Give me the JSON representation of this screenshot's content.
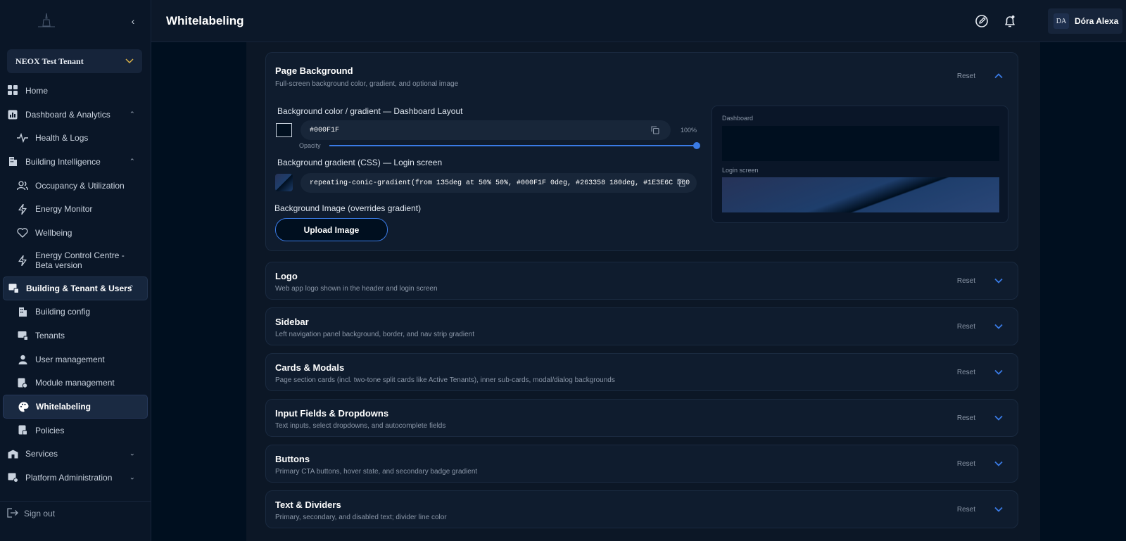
{
  "app": {
    "tenant": "NEOX Test Tenant",
    "page_title": "Whitelabeling",
    "user": {
      "initials": "DA",
      "name": "Dóra Alexa"
    },
    "sign_out": "Sign out"
  },
  "sidebar": {
    "items": [
      {
        "label": "Home",
        "icon": "grid-icon"
      },
      {
        "label": "Dashboard & Analytics",
        "icon": "chart-icon"
      },
      {
        "label": "Health & Logs",
        "icon": "pulse-icon"
      },
      {
        "label": "Building Intelligence",
        "icon": "building-icon"
      },
      {
        "label": "Occupancy & Utilization",
        "icon": "users-icon"
      },
      {
        "label": "Energy Monitor",
        "icon": "bolt-icon"
      },
      {
        "label": "Wellbeing",
        "icon": "heart-icon"
      },
      {
        "label": "Energy Control Centre - Beta version",
        "icon": "bolt-icon"
      },
      {
        "label": "Building & Tenant & Users",
        "icon": "org-icon"
      },
      {
        "label": "Building config",
        "icon": "building-icon"
      },
      {
        "label": "Tenants",
        "icon": "tenants-icon"
      },
      {
        "label": "User management",
        "icon": "user-icon"
      },
      {
        "label": "Module management",
        "icon": "module-icon"
      },
      {
        "label": "Whitelabeling",
        "icon": "palette-icon"
      },
      {
        "label": "Policies",
        "icon": "policy-icon"
      },
      {
        "label": "Services",
        "icon": "services-icon"
      },
      {
        "label": "Platform Administration",
        "icon": "admin-icon"
      }
    ]
  },
  "page_background": {
    "title": "Page Background",
    "subtitle": "Full-screen background color, gradient, and optional image",
    "reset": "Reset",
    "bg_color_label": "Background color / gradient — Dashboard Layout",
    "bg_color_value": "#000F1F",
    "opacity_label": "Opacity",
    "opacity_value": "100%",
    "opacity_fraction": 1.0,
    "gradient_label": "Background gradient (CSS) — Login screen",
    "gradient_value": "repeating-conic-gradient(from 135deg at 50% 50%, #000F1F 0deg, #263358 180deg, #1E3E6C 360",
    "image_label": "Background Image (overrides gradient)",
    "upload_label": "Upload Image",
    "preview_dashboard": "Dashboard",
    "preview_login": "Login screen"
  },
  "sections": [
    {
      "title": "Logo",
      "subtitle": "Web app logo shown in the header and login screen",
      "reset": "Reset"
    },
    {
      "title": "Sidebar",
      "subtitle": "Left navigation panel background, border, and nav strip gradient",
      "reset": "Reset"
    },
    {
      "title": "Cards & Modals",
      "subtitle": "Page section cards (incl. two-tone split cards like Active Tenants), inner sub-cards, modal/dialog backgrounds",
      "reset": "Reset"
    },
    {
      "title": "Input Fields & Dropdowns",
      "subtitle": "Text inputs, select dropdowns, and autocomplete fields",
      "reset": "Reset"
    },
    {
      "title": "Buttons",
      "subtitle": "Primary CTA buttons, hover state, and secondary badge gradient",
      "reset": "Reset"
    },
    {
      "title": "Text & Dividers",
      "subtitle": "Primary, secondary, and disabled text; divider line color",
      "reset": "Reset"
    }
  ],
  "colors": {
    "accent": "#3a7be6",
    "background": "#000F1F",
    "tenant_chevron": "#d8b04a"
  }
}
